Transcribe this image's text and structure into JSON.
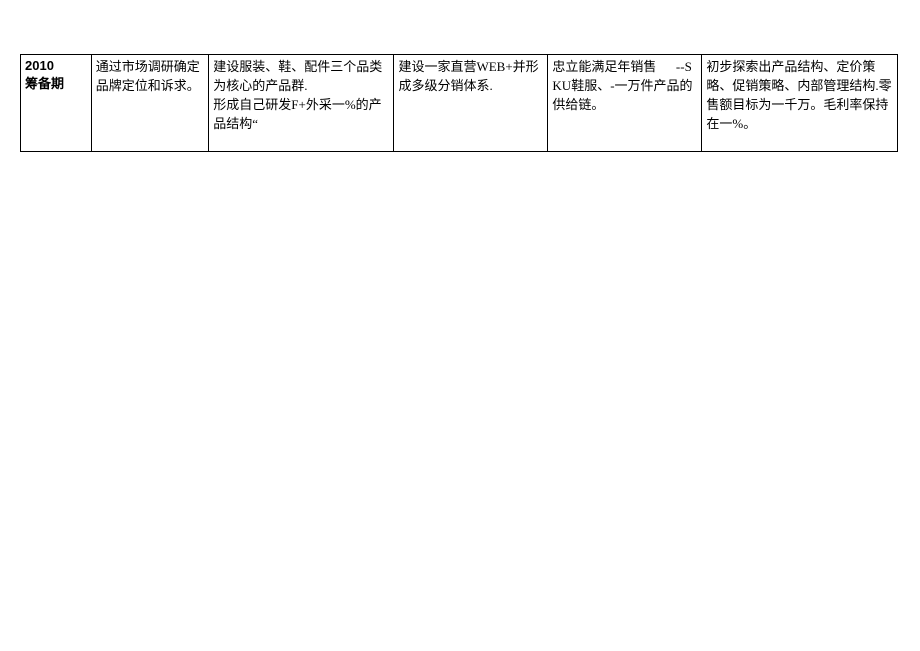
{
  "table": {
    "rows": [
      {
        "period_year": "2010",
        "period_phase": "筹备期",
        "c1": "通过市场调研确定品牌定位和诉求。",
        "c2_line1": "建设服装、鞋、配件三个品类为核心的产品群.",
        "c2_line2": "形成自己研发F+外采一%的产品结构“",
        "c3": "建设一家直营WEB+并形成多级分销体系.",
        "c4": "忠立能满足年销售      --SKU鞋服、-一万件产品的供给链。",
        "c5": "初步探索出产品结构、定价策略、促销策略、内部管理结构.零售额目标为一千万。毛利率保持在一%。"
      }
    ]
  }
}
